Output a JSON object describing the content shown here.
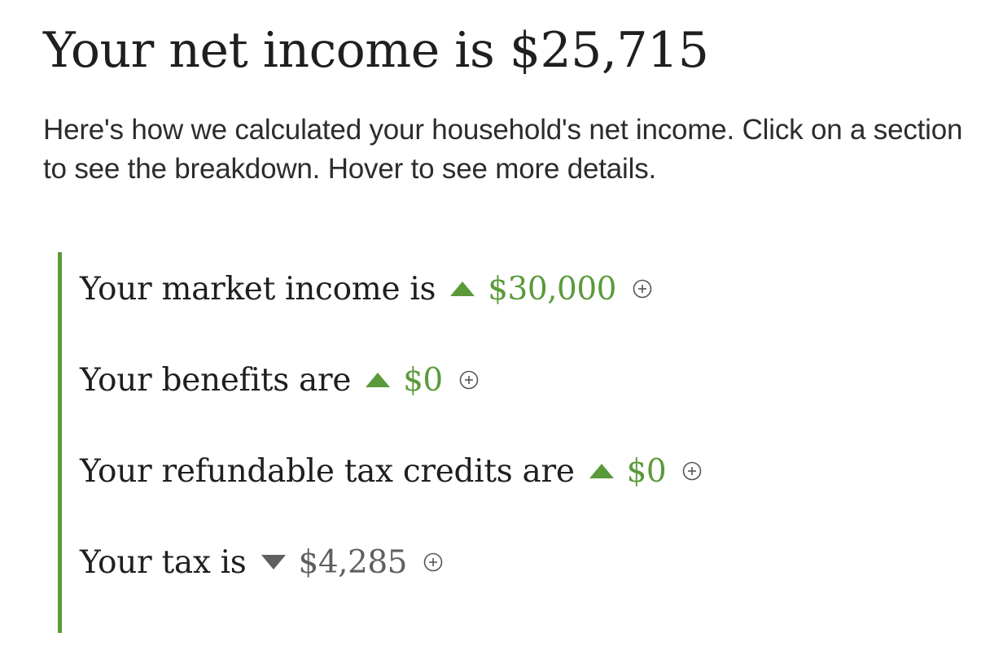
{
  "header": {
    "title": "Your net income is $25,715",
    "intro": "Here's how we calculated your household's net income. Click on a section to see the breakdown. Hover to see more details."
  },
  "colors": {
    "accent_green": "#5a9a3a",
    "negative_grey": "#5f5f5f",
    "text_dark": "#1f1f1f"
  },
  "breakdown": {
    "items": [
      {
        "label": "Your market income is",
        "direction": "up",
        "amount": "$30,000",
        "icon": "plus-circle-icon"
      },
      {
        "label": "Your benefits are",
        "direction": "up",
        "amount": "$0",
        "icon": "plus-circle-icon"
      },
      {
        "label": "Your refundable tax credits are",
        "direction": "up",
        "amount": "$0",
        "icon": "plus-circle-icon"
      },
      {
        "label": "Your tax is",
        "direction": "down",
        "amount": "$4,285",
        "icon": "plus-circle-icon"
      }
    ]
  }
}
